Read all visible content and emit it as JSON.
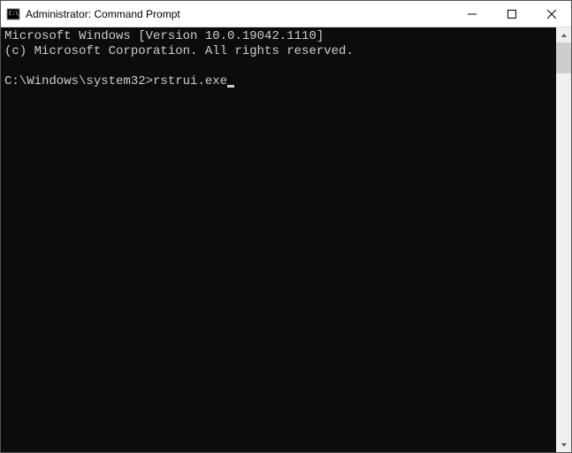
{
  "window": {
    "title": "Administrator: Command Prompt"
  },
  "terminal": {
    "line1": "Microsoft Windows [Version 10.0.19042.1110]",
    "line2": "(c) Microsoft Corporation. All rights reserved.",
    "prompt": "C:\\Windows\\system32>",
    "command": "rstrui.exe"
  }
}
